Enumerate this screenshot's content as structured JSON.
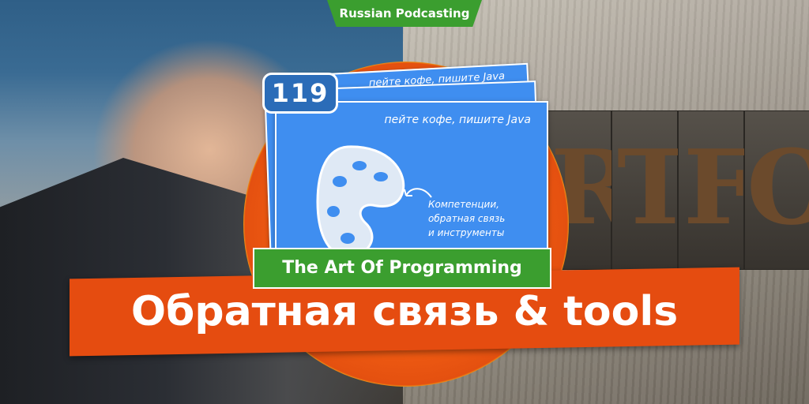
{
  "badge": {
    "text": "Russian Podcasting"
  },
  "episode": {
    "number": "119"
  },
  "card": {
    "slogan": "пейте кофе, пишите Java",
    "note_lines": [
      "Компетенции,",
      "обратная связь",
      "и инструменты"
    ]
  },
  "show": {
    "title": "The Art Of Programming"
  },
  "episode_title": "Обратная связь & tools",
  "background": {
    "letterpress": [
      "R",
      "T",
      "F",
      "O"
    ]
  },
  "colors": {
    "green": "#3b9e2f",
    "orange": "#e54c10",
    "blue": "#3f8ef0",
    "yellow": "#f1b21a"
  },
  "icons": [
    "palette-icon",
    "arrow-icon"
  ]
}
